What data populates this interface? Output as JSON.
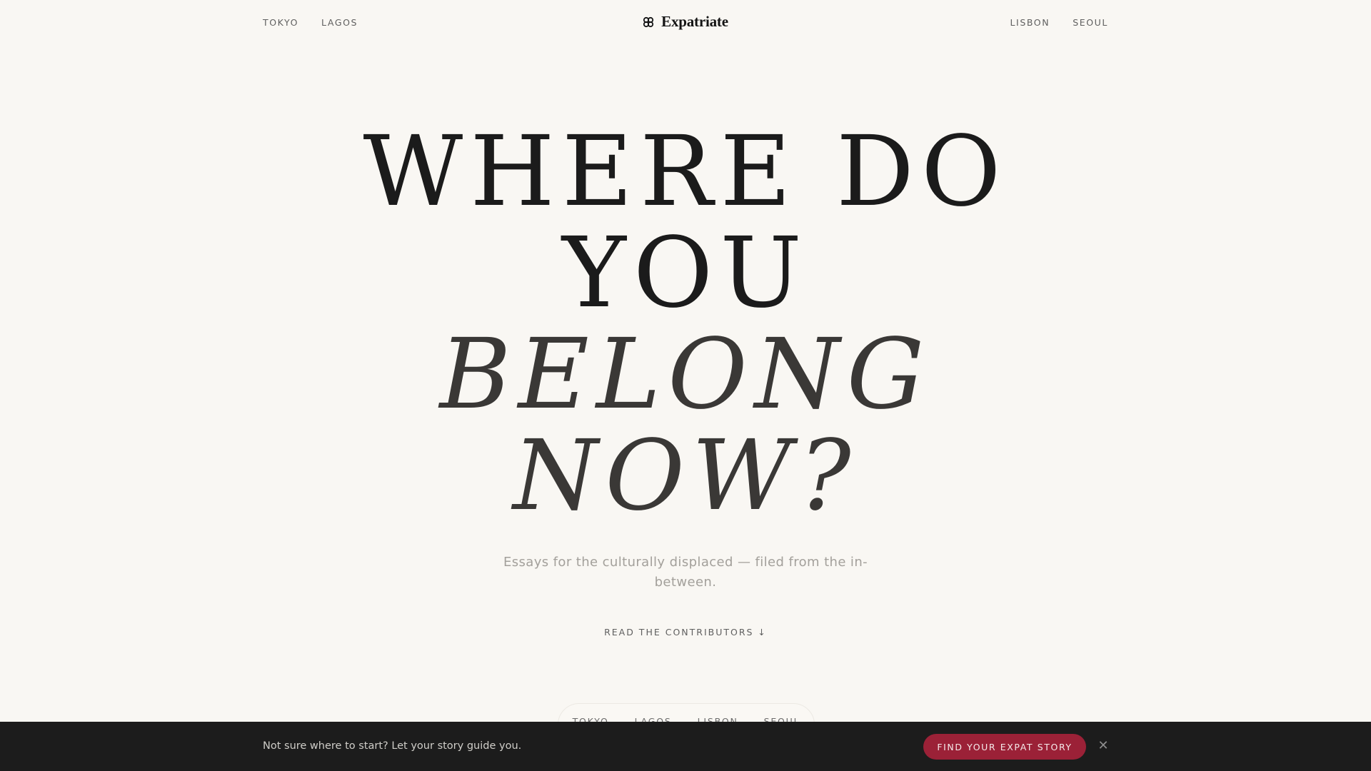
{
  "header": {
    "left_links": [
      "TOKYO",
      "LAGOS"
    ],
    "right_links": [
      "LISBON",
      "SEOUL"
    ],
    "brand": "Expatriate",
    "brand_icon": "clover-icon"
  },
  "hero": {
    "line1": "WHERE DO",
    "line2": "YOU",
    "line3": "BELONG",
    "line4": "NOW?",
    "subtitle": "Essays for the culturally displaced — filed from the in-between.",
    "cta": "READ THE CONTRIBUTORS ↓"
  },
  "pill_nav": [
    "TOKYO",
    "LAGOS",
    "LISBON",
    "SEOUL"
  ],
  "bottom_bar": {
    "message": "Not sure where to start? Let your story guide you.",
    "button": "FIND YOUR EXPAT STORY",
    "close_icon": "close-icon"
  },
  "colors": {
    "background": "#f9f7f3",
    "accent": "#9b2137",
    "bar": "#1c1c1c"
  }
}
